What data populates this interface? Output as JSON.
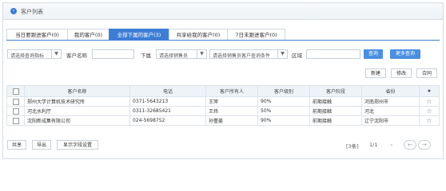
{
  "panel": {
    "title": "客户列表"
  },
  "tabs": [
    {
      "label": "当日要跟进客户(0)",
      "active": false
    },
    {
      "label": "我的客户(0)",
      "active": false
    },
    {
      "label": "全部下属的客户(3)",
      "active": true
    },
    {
      "label": "共享给我的客户(0)",
      "active": false
    },
    {
      "label": "7日未跟进客户(0)",
      "active": false
    }
  ],
  "filters": {
    "query_condition": "请选择查询指标",
    "customer_name_label": "客户名称",
    "subordinate_label": "下属",
    "salesperson_placeholder": "请选择销售员",
    "salesperson_query": "请选择销售员客户查询条件",
    "area_label": "区域",
    "search_button": "查询",
    "more_button": "更多查询"
  },
  "actions": {
    "new": "新建",
    "edit": "修改",
    "merge": "合同"
  },
  "table": {
    "columns": [
      "客户名称",
      "电话",
      "客户所有人",
      "客户级别",
      "客户阶段",
      "省份",
      "★"
    ],
    "rows": [
      {
        "name": "郑州大学计算机技术研究所",
        "phone": "0371-5643213",
        "owner": "王萍",
        "level": "90%",
        "stage": "前期接触",
        "province": "河南郑州市"
      },
      {
        "name": "河北水利厅",
        "phone": "0311-32685421",
        "owner": "王炜",
        "level": "50%",
        "stage": "前期接触",
        "province": "河北"
      },
      {
        "name": "沈阳新成集有限公司",
        "phone": "024-5698752",
        "owner": "孙蕾姜",
        "level": "90%",
        "stage": "前期接触",
        "province": "辽宁沈阳市"
      }
    ]
  },
  "footer": {
    "share": "共享",
    "export": "导出",
    "display_settings": "显示字段设置",
    "count": "[3条]",
    "page": "1/1",
    "page_arrow": "⌄"
  }
}
